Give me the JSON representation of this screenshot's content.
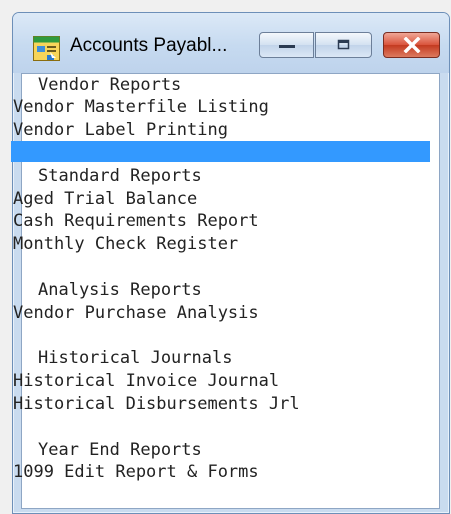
{
  "window": {
    "title": "Accounts Payabl...",
    "buttons": {
      "minimize": "minimize-icon",
      "maximize": "maximize-icon",
      "close": "close-icon"
    }
  },
  "menu": {
    "vendor_heading": "Vendor Reports",
    "vendor_items": [
      "Vendor Masterfile Listing",
      "Vendor Label Printing"
    ],
    "standard_heading": "Standard Reports",
    "standard_items": [
      "Aged Trial Balance",
      "Cash Requirements Report",
      "Monthly Check Register"
    ],
    "analysis_heading": "Analysis Reports",
    "analysis_items": [
      "Vendor Purchase Analysis"
    ],
    "historical_heading": "Historical Journals",
    "historical_items": [
      "Historical Invoice Journal",
      "Historical Disbursements Jrl"
    ],
    "yearend_heading": "Year End Reports",
    "yearend_items": [
      "1099 Edit Report & Forms"
    ]
  },
  "colors": {
    "selection": "#3399ff",
    "close_button": "#c43a20"
  }
}
